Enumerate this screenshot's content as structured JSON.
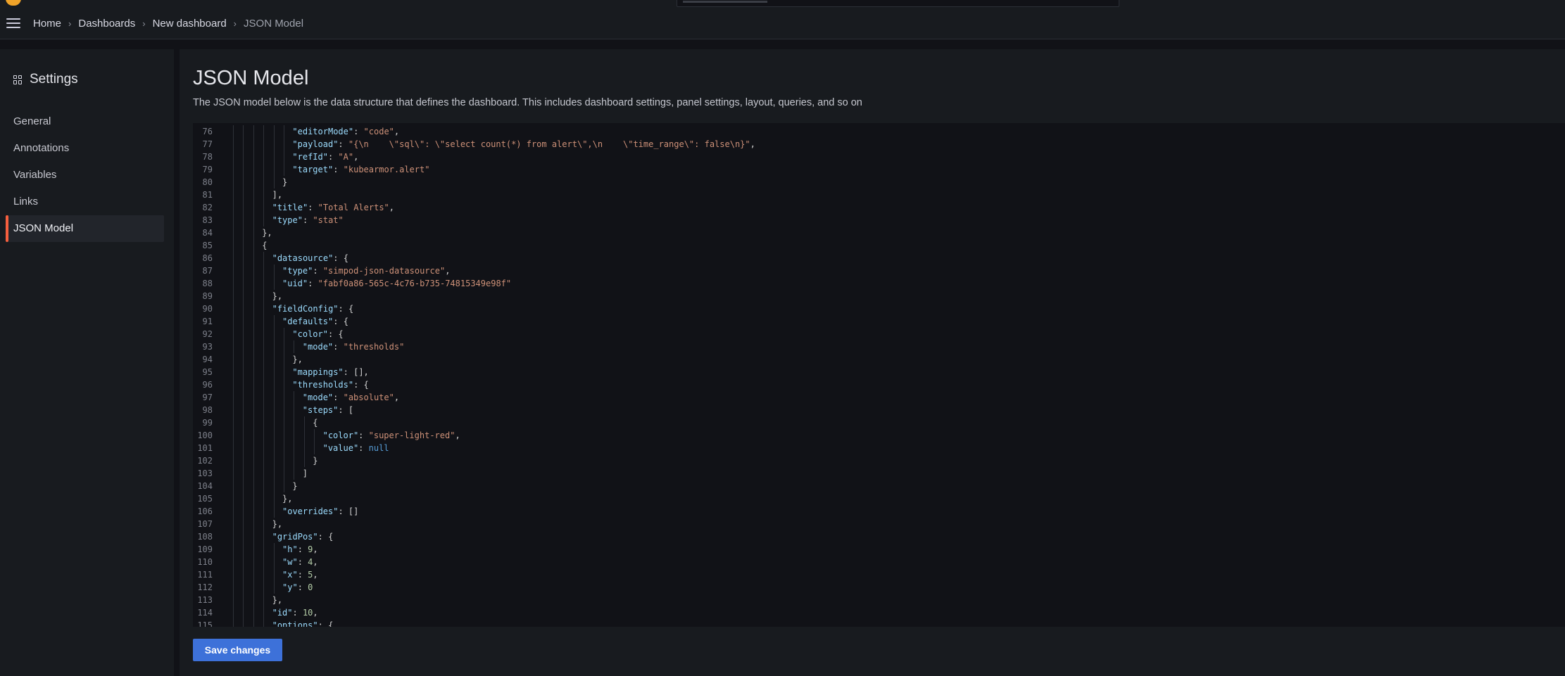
{
  "breadcrumb": {
    "items": [
      "Home",
      "Dashboards",
      "New dashboard"
    ],
    "current": "JSON Model"
  },
  "sidebar": {
    "title": "Settings",
    "items": [
      {
        "label": "General"
      },
      {
        "label": "Annotations"
      },
      {
        "label": "Variables"
      },
      {
        "label": "Links"
      },
      {
        "label": "JSON Model",
        "active": true
      }
    ]
  },
  "main": {
    "title": "JSON Model",
    "description": "The JSON model below is the data structure that defines the dashboard. This includes dashboard settings, panel settings, layout, queries, and so on",
    "save_label": "Save changes"
  },
  "editor": {
    "lines": [
      {
        "n": "76",
        "indent": 6,
        "t": [
          [
            "k",
            "\"editorMode\""
          ],
          [
            "p",
            ": "
          ],
          [
            "s",
            "\"code\""
          ],
          [
            "p",
            ","
          ]
        ]
      },
      {
        "n": "77",
        "indent": 6,
        "t": [
          [
            "k",
            "\"payload\""
          ],
          [
            "p",
            ": "
          ],
          [
            "s",
            "\"{\\n    \\\"sql\\\": \\\"select count(*) from alert\\\",\\n    \\\"time_range\\\": false\\n}\""
          ],
          [
            "p",
            ","
          ]
        ]
      },
      {
        "n": "78",
        "indent": 6,
        "t": [
          [
            "k",
            "\"refId\""
          ],
          [
            "p",
            ": "
          ],
          [
            "s",
            "\"A\""
          ],
          [
            "p",
            ","
          ]
        ]
      },
      {
        "n": "79",
        "indent": 6,
        "t": [
          [
            "k",
            "\"target\""
          ],
          [
            "p",
            ": "
          ],
          [
            "s",
            "\"kubearmor.alert\""
          ]
        ]
      },
      {
        "n": "80",
        "indent": 5,
        "t": [
          [
            "p",
            "}"
          ]
        ]
      },
      {
        "n": "81",
        "indent": 4,
        "t": [
          [
            "p",
            "],"
          ]
        ]
      },
      {
        "n": "82",
        "indent": 4,
        "t": [
          [
            "k",
            "\"title\""
          ],
          [
            "p",
            ": "
          ],
          [
            "s",
            "\"Total Alerts\""
          ],
          [
            "p",
            ","
          ]
        ]
      },
      {
        "n": "83",
        "indent": 4,
        "t": [
          [
            "k",
            "\"type\""
          ],
          [
            "p",
            ": "
          ],
          [
            "s",
            "\"stat\""
          ]
        ]
      },
      {
        "n": "84",
        "indent": 3,
        "t": [
          [
            "p",
            "},"
          ]
        ]
      },
      {
        "n": "85",
        "indent": 3,
        "t": [
          [
            "p",
            "{"
          ]
        ]
      },
      {
        "n": "86",
        "indent": 4,
        "t": [
          [
            "k",
            "\"datasource\""
          ],
          [
            "p",
            ": {"
          ]
        ]
      },
      {
        "n": "87",
        "indent": 5,
        "t": [
          [
            "k",
            "\"type\""
          ],
          [
            "p",
            ": "
          ],
          [
            "s",
            "\"simpod-json-datasource\""
          ],
          [
            "p",
            ","
          ]
        ]
      },
      {
        "n": "88",
        "indent": 5,
        "t": [
          [
            "k",
            "\"uid\""
          ],
          [
            "p",
            ": "
          ],
          [
            "s",
            "\"fabf0a86-565c-4c76-b735-74815349e98f\""
          ]
        ]
      },
      {
        "n": "89",
        "indent": 4,
        "t": [
          [
            "p",
            "},"
          ]
        ]
      },
      {
        "n": "90",
        "indent": 4,
        "t": [
          [
            "k",
            "\"fieldConfig\""
          ],
          [
            "p",
            ": {"
          ]
        ]
      },
      {
        "n": "91",
        "indent": 5,
        "t": [
          [
            "k",
            "\"defaults\""
          ],
          [
            "p",
            ": {"
          ]
        ]
      },
      {
        "n": "92",
        "indent": 6,
        "t": [
          [
            "k",
            "\"color\""
          ],
          [
            "p",
            ": {"
          ]
        ]
      },
      {
        "n": "93",
        "indent": 7,
        "t": [
          [
            "k",
            "\"mode\""
          ],
          [
            "p",
            ": "
          ],
          [
            "s",
            "\"thresholds\""
          ]
        ]
      },
      {
        "n": "94",
        "indent": 6,
        "t": [
          [
            "p",
            "},"
          ]
        ]
      },
      {
        "n": "95",
        "indent": 6,
        "t": [
          [
            "k",
            "\"mappings\""
          ],
          [
            "p",
            ": [],"
          ]
        ]
      },
      {
        "n": "96",
        "indent": 6,
        "t": [
          [
            "k",
            "\"thresholds\""
          ],
          [
            "p",
            ": {"
          ]
        ]
      },
      {
        "n": "97",
        "indent": 7,
        "t": [
          [
            "k",
            "\"mode\""
          ],
          [
            "p",
            ": "
          ],
          [
            "s",
            "\"absolute\""
          ],
          [
            "p",
            ","
          ]
        ]
      },
      {
        "n": "98",
        "indent": 7,
        "t": [
          [
            "k",
            "\"steps\""
          ],
          [
            "p",
            ": ["
          ]
        ]
      },
      {
        "n": "99",
        "indent": 8,
        "t": [
          [
            "p",
            "{"
          ]
        ]
      },
      {
        "n": "100",
        "indent": 9,
        "t": [
          [
            "k",
            "\"color\""
          ],
          [
            "p",
            ": "
          ],
          [
            "s",
            "\"super-light-red\""
          ],
          [
            "p",
            ","
          ]
        ]
      },
      {
        "n": "101",
        "indent": 9,
        "t": [
          [
            "k",
            "\"value\""
          ],
          [
            "p",
            ": "
          ],
          [
            "kw",
            "null"
          ]
        ]
      },
      {
        "n": "102",
        "indent": 8,
        "t": [
          [
            "p",
            "}"
          ]
        ]
      },
      {
        "n": "103",
        "indent": 7,
        "t": [
          [
            "p",
            "]"
          ]
        ]
      },
      {
        "n": "104",
        "indent": 6,
        "t": [
          [
            "p",
            "}"
          ]
        ]
      },
      {
        "n": "105",
        "indent": 5,
        "t": [
          [
            "p",
            "},"
          ]
        ]
      },
      {
        "n": "106",
        "indent": 5,
        "t": [
          [
            "k",
            "\"overrides\""
          ],
          [
            "p",
            ": []"
          ]
        ]
      },
      {
        "n": "107",
        "indent": 4,
        "t": [
          [
            "p",
            "},"
          ]
        ]
      },
      {
        "n": "108",
        "indent": 4,
        "t": [
          [
            "k",
            "\"gridPos\""
          ],
          [
            "p",
            ": {"
          ]
        ]
      },
      {
        "n": "109",
        "indent": 5,
        "t": [
          [
            "k",
            "\"h\""
          ],
          [
            "p",
            ": "
          ],
          [
            "n",
            "9"
          ],
          [
            "p",
            ","
          ]
        ]
      },
      {
        "n": "110",
        "indent": 5,
        "t": [
          [
            "k",
            "\"w\""
          ],
          [
            "p",
            ": "
          ],
          [
            "n",
            "4"
          ],
          [
            "p",
            ","
          ]
        ]
      },
      {
        "n": "111",
        "indent": 5,
        "t": [
          [
            "k",
            "\"x\""
          ],
          [
            "p",
            ": "
          ],
          [
            "n",
            "5"
          ],
          [
            "p",
            ","
          ]
        ]
      },
      {
        "n": "112",
        "indent": 5,
        "t": [
          [
            "k",
            "\"y\""
          ],
          [
            "p",
            ": "
          ],
          [
            "n",
            "0"
          ]
        ]
      },
      {
        "n": "113",
        "indent": 4,
        "t": [
          [
            "p",
            "},"
          ]
        ]
      },
      {
        "n": "114",
        "indent": 4,
        "t": [
          [
            "k",
            "\"id\""
          ],
          [
            "p",
            ": "
          ],
          [
            "n",
            "10"
          ],
          [
            "p",
            ","
          ]
        ]
      },
      {
        "n": "115",
        "indent": 4,
        "t": [
          [
            "k",
            "\"options\""
          ],
          [
            "p",
            ": {"
          ]
        ]
      }
    ]
  },
  "colors": {
    "accent": "#f55f3e",
    "primary_button": "#3d71d9",
    "json_key": "#9cdcfe",
    "json_string": "#ce9178",
    "json_number": "#b5cea8",
    "json_keyword": "#569cd6"
  },
  "icons": {
    "menu": "hamburger-menu-icon",
    "settings": "grid-settings-icon",
    "separator": "chevron-right-icon"
  }
}
